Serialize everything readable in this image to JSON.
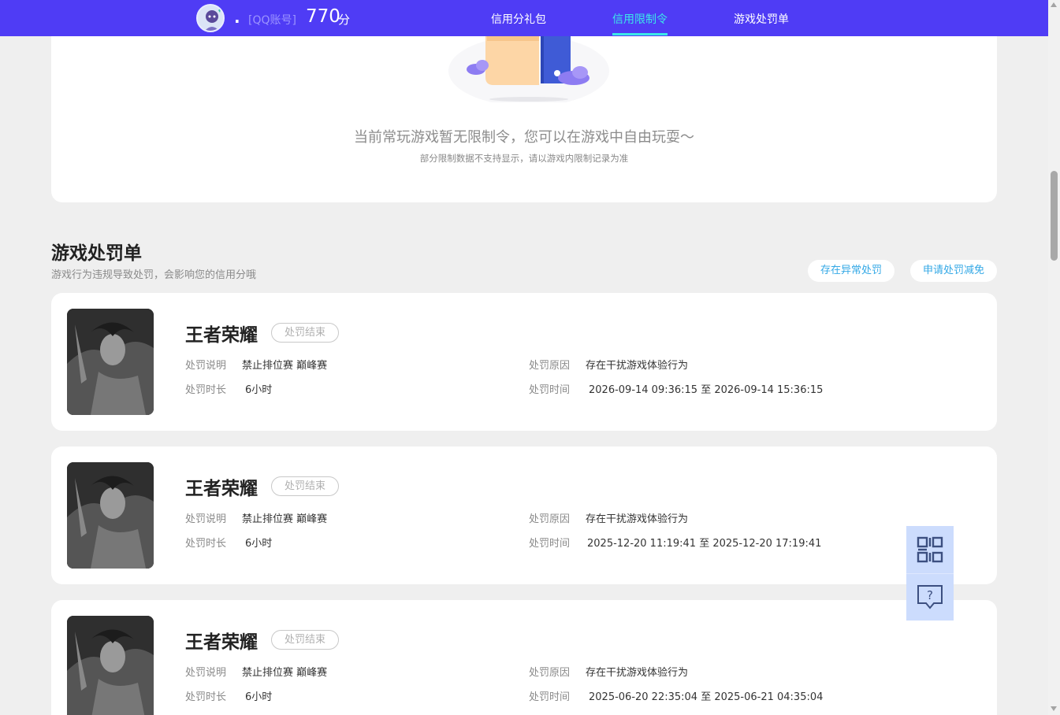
{
  "header": {
    "nickname": ".",
    "account_type": "[QQ账号]",
    "score": "770",
    "score_unit": "分",
    "nav": [
      {
        "label": "信用分礼包",
        "active": false
      },
      {
        "label": "信用限制令",
        "active": true
      },
      {
        "label": "游戏处罚单",
        "active": false
      }
    ]
  },
  "restriction": {
    "main_text": "当前常玩游戏暂无限制令，您可以在游戏中自由玩耍～",
    "sub_text": "部分限制数据不支持显示，请以游戏内限制记录为准"
  },
  "penalty_section": {
    "title": "游戏处罚单",
    "subtitle": "游戏行为违规导致处罚，会影响您的信用分哦",
    "abnormal_button": "存在异常处罚",
    "appeal_button": "申请处罚减免"
  },
  "labels": {
    "desc": "处罚说明",
    "reason": "处罚原因",
    "duration": "处罚时长",
    "time": "处罚时间"
  },
  "penalties": [
    {
      "game": "王者荣耀",
      "status": "处罚结束",
      "description": "禁止排位赛 巅峰赛",
      "reason": "存在干扰游戏体验行为",
      "duration": "6小时",
      "time": "2026-09-14 09:36:15 至 2026-09-14 15:36:15"
    },
    {
      "game": "王者荣耀",
      "status": "处罚结束",
      "description": "禁止排位赛 巅峰赛",
      "reason": "存在干扰游戏体验行为",
      "duration": "6小时",
      "time": "2025-12-20 11:19:41 至 2025-12-20 17:19:41"
    },
    {
      "game": "王者荣耀",
      "status": "处罚结束",
      "description": "禁止排位赛 巅峰赛",
      "reason": "存在干扰游戏体验行为",
      "duration": "6小时",
      "time": "2025-06-20 22:35:04 至 2025-06-21 04:35:04"
    }
  ],
  "icons": {
    "qrcode": "qrcode-icon",
    "help": "help-chat-icon"
  },
  "colors": {
    "header_bg": "#4f3cf5",
    "nav_active": "#3be8e8",
    "link_blue": "#33a8e6",
    "float_bg": "#ccdcfd"
  }
}
